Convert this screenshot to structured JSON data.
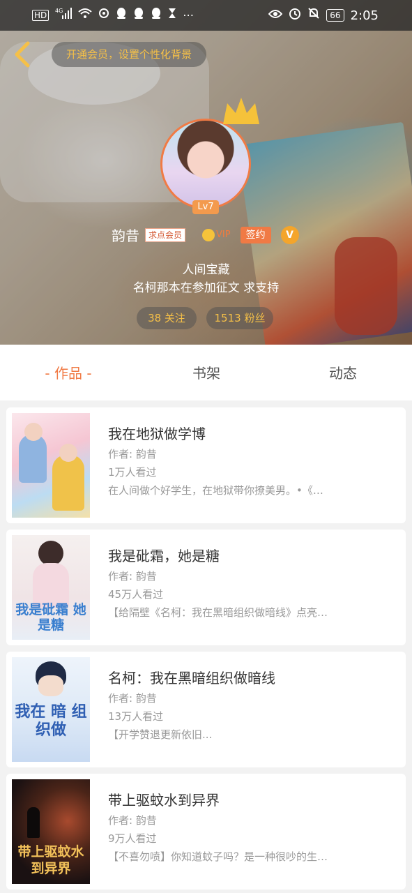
{
  "status_bar": {
    "network": "HD",
    "signal": "4G",
    "time": "2:05",
    "battery": "66"
  },
  "header": {
    "vip_banner": "开通会员，设置个性化背景",
    "level": "Lv7",
    "username": "韵昔",
    "member_tag": "求点会员",
    "vip_label": "VIP",
    "signed_label": "签约",
    "verified_label": "V",
    "motto_line1": "人间宝藏",
    "motto_line2": "名柯那本在参加征文 求支持",
    "following": "38 关注",
    "followers": "1513 粉丝"
  },
  "tabs": [
    {
      "label": "- 作品 -",
      "active": true
    },
    {
      "label": "书架",
      "active": false
    },
    {
      "label": "动态",
      "active": false
    }
  ],
  "books": [
    {
      "title": "我在地狱做学博",
      "author": "作者: 韵昔",
      "reads": "1万人看过",
      "description": "在人间做个好学生，在地狱带你撩美男。•《…"
    },
    {
      "title": "我是砒霜，她是糖",
      "author": "作者: 韵昔",
      "reads": "45万人看过",
      "description": "【给隔壁《名柯：我在黑暗组织做暗线》点亮…",
      "cover_text": "我是砒霜 她是糖"
    },
    {
      "title": "名柯：我在黑暗组织做暗线",
      "author": "作者: 韵昔",
      "reads": "13万人看过",
      "description": "【开学赞退更新依旧...",
      "cover_text": "我在 暗 组织做"
    },
    {
      "title": "带上驱蚊水到异界",
      "author": "作者: 韵昔",
      "reads": "9万人看过",
      "description": "【不喜勿喷】你知道蚊子吗？是一种很吵的生…",
      "cover_text": "带上驱蚊水 到异界"
    }
  ],
  "colors": {
    "accent": "#f07a45",
    "gold": "#f5c048"
  }
}
